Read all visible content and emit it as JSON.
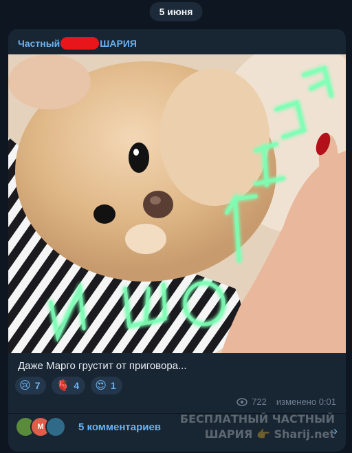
{
  "date_label": "5 июня",
  "channel": {
    "title_left": "Частный",
    "title_right": "ШАРИЯ"
  },
  "image_text": {
    "left": "И ШО",
    "right": "ТЕПЛА"
  },
  "caption": "Даже Марго грустит от приговора...",
  "reactions": [
    {
      "emoji": "😢",
      "count": "7"
    },
    {
      "emoji": "🫀",
      "count": "4"
    },
    {
      "emoji": "😍",
      "count": "1"
    }
  ],
  "meta": {
    "views": "722",
    "edited": "изменено 0:01"
  },
  "comments": {
    "label": "5 комментариев",
    "avatar_letter": "М"
  },
  "watermark": {
    "line1": "БЕСПЛАТНЫЙ ЧАСТНЫЙ",
    "line2": "ШАРИЯ",
    "line3": "Sharij.net"
  },
  "colors": {
    "accent": "#6ab2f2",
    "card": "#182533",
    "background": "#0e1621",
    "neon": "#7dffb5"
  }
}
